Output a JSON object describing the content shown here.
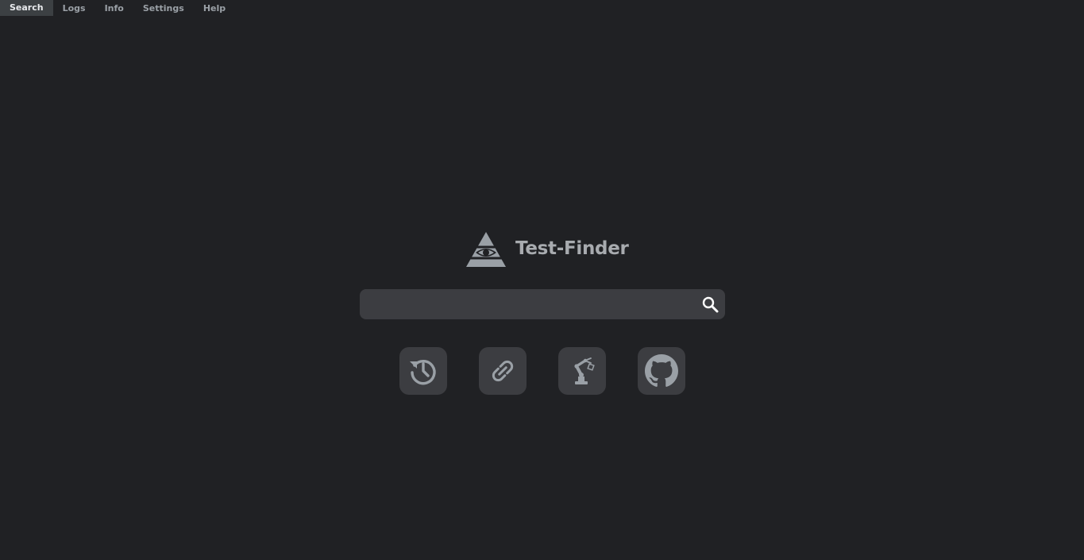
{
  "nav": {
    "tabs": [
      {
        "label": "Search",
        "active": true
      },
      {
        "label": "Logs",
        "active": false
      },
      {
        "label": "Info",
        "active": false
      },
      {
        "label": "Settings",
        "active": false
      },
      {
        "label": "Help",
        "active": false
      }
    ]
  },
  "brand": {
    "title": "Test-Finder",
    "logo_icon": "eye-pyramid-icon"
  },
  "search": {
    "value": "",
    "placeholder": "",
    "button_icon": "magnifier-icon"
  },
  "actions": [
    {
      "icon": "history-icon"
    },
    {
      "icon": "link-icon"
    },
    {
      "icon": "robot-arm-icon"
    },
    {
      "icon": "github-icon"
    }
  ],
  "colors": {
    "background": "#202124",
    "surface": "#3c3d41",
    "icon": "#9aa0a6",
    "title": "#a8abaf",
    "active_tab_bg": "#3c4043"
  }
}
